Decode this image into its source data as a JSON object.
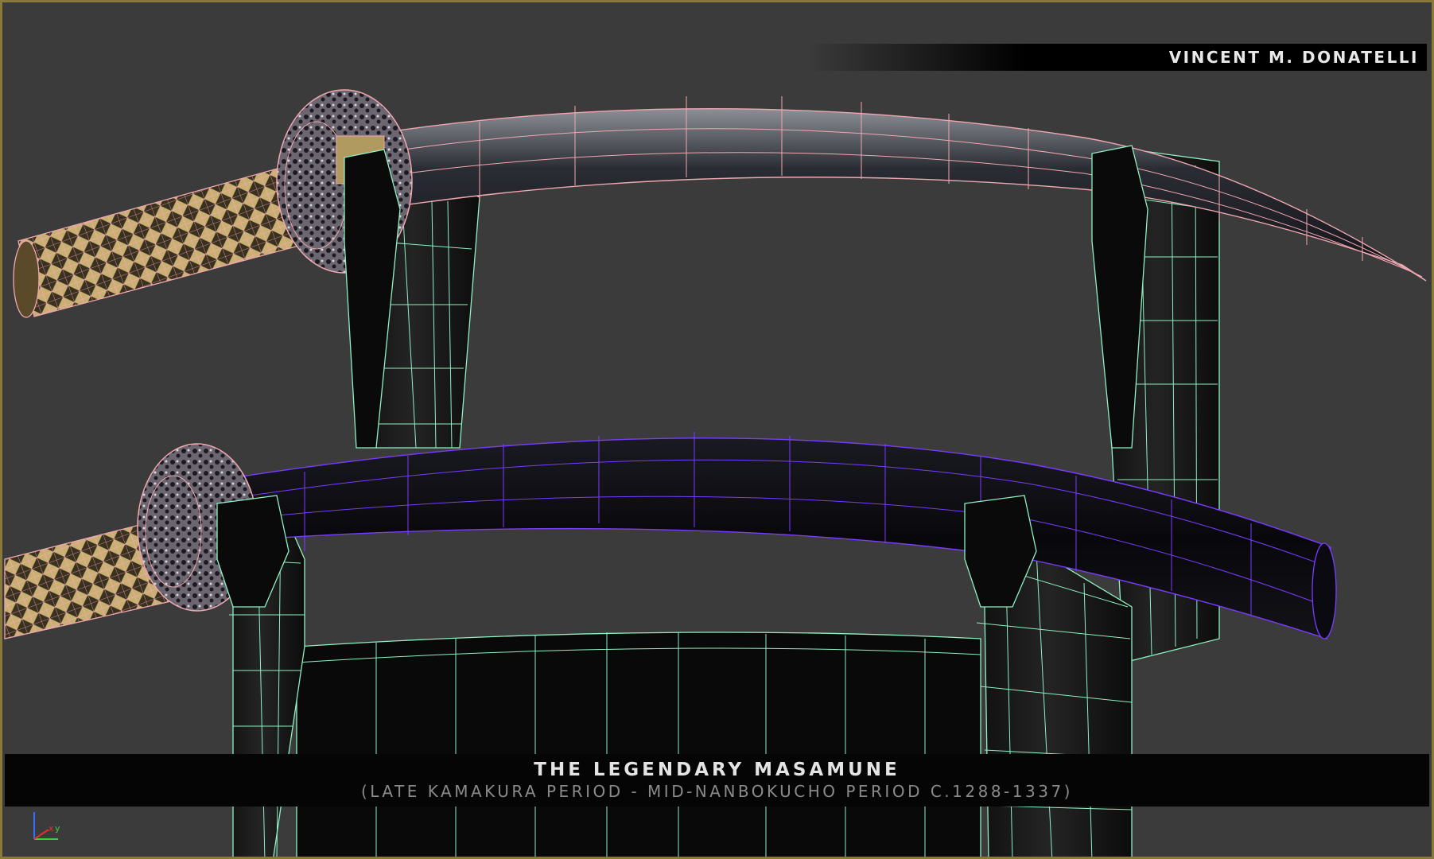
{
  "viewport": {
    "author": "VINCENT M. DONATELLI",
    "title": "THE LEGENDARY MASAMUNE",
    "subtitle": "(LATE KAMAKURA PERIOD - MID-NANBOKUCHO PERIOD C.1288-1337)",
    "axis_labels": {
      "x": "x",
      "y": "y"
    }
  },
  "colors": {
    "background": "#3b3b3b",
    "border": "#8a7a3a",
    "stand_wire": "#8ff0c4",
    "blade_wire": "#f0a8b0",
    "scabbard_wire": "#7a3cff",
    "handle_wrap": "#c8b070"
  }
}
